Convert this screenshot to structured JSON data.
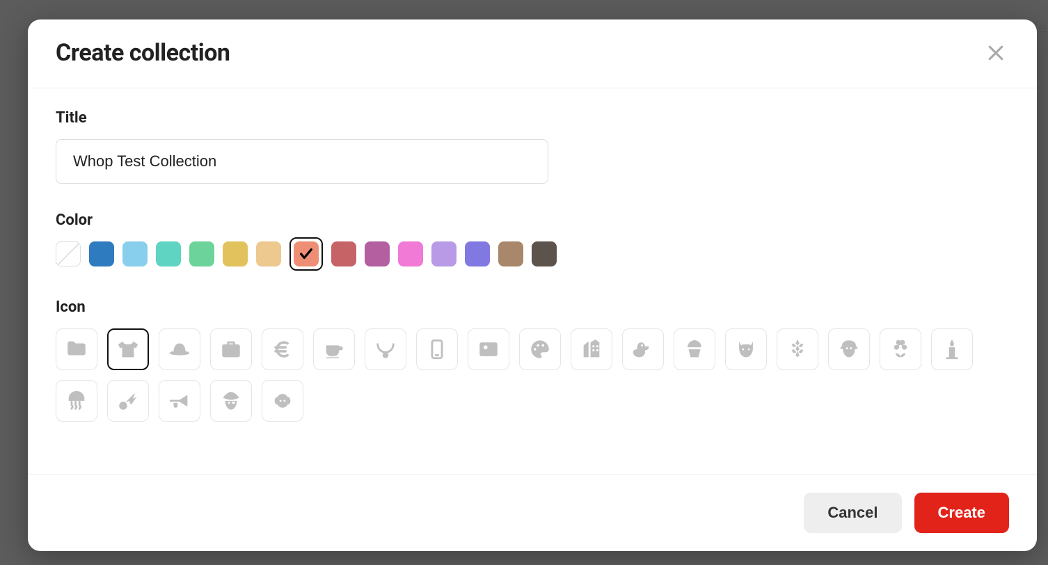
{
  "modal": {
    "title": "Create collection",
    "titleField": {
      "label": "Title",
      "value": "Whop Test Collection"
    },
    "colorField": {
      "label": "Color",
      "colors": [
        {
          "name": "none",
          "hex": "none"
        },
        {
          "name": "blue",
          "hex": "#2f7bbf"
        },
        {
          "name": "sky",
          "hex": "#87cfed"
        },
        {
          "name": "teal",
          "hex": "#5fd4c2"
        },
        {
          "name": "green",
          "hex": "#6cd49a"
        },
        {
          "name": "gold",
          "hex": "#e2c25c"
        },
        {
          "name": "tan",
          "hex": "#edc98f"
        },
        {
          "name": "coral",
          "hex": "#ee8f75",
          "selected": true
        },
        {
          "name": "rose",
          "hex": "#c66367"
        },
        {
          "name": "plum",
          "hex": "#b45fa0"
        },
        {
          "name": "pink",
          "hex": "#f07ad6"
        },
        {
          "name": "lavender",
          "hex": "#b89ae6"
        },
        {
          "name": "violet",
          "hex": "#8278e2"
        },
        {
          "name": "brown",
          "hex": "#a9876a"
        },
        {
          "name": "charcoal",
          "hex": "#5b534c"
        }
      ]
    },
    "iconField": {
      "label": "Icon",
      "icons": [
        {
          "name": "folder"
        },
        {
          "name": "tshirt",
          "selected": true
        },
        {
          "name": "hat"
        },
        {
          "name": "briefcase"
        },
        {
          "name": "euro"
        },
        {
          "name": "coffee"
        },
        {
          "name": "necklace"
        },
        {
          "name": "phone"
        },
        {
          "name": "image"
        },
        {
          "name": "palette"
        },
        {
          "name": "building"
        },
        {
          "name": "duck"
        },
        {
          "name": "cupcake"
        },
        {
          "name": "cat"
        },
        {
          "name": "wheat"
        },
        {
          "name": "dog"
        },
        {
          "name": "flower"
        },
        {
          "name": "candle"
        },
        {
          "name": "jellyfish"
        },
        {
          "name": "shuttlecock"
        },
        {
          "name": "trumpet"
        },
        {
          "name": "pirate"
        },
        {
          "name": "sheep"
        }
      ]
    },
    "buttons": {
      "cancel": "Cancel",
      "create": "Create"
    }
  }
}
